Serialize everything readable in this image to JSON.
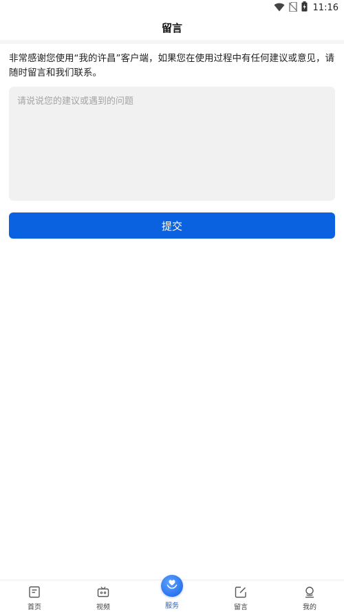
{
  "status_bar": {
    "time": "11:16",
    "icons": [
      "wifi-icon",
      "no-sim-icon",
      "battery-charging-icon"
    ]
  },
  "header": {
    "title": "留言"
  },
  "intro_text": "非常感谢您使用“我的许昌”客户端，如果您在使用过程中有任何建议或意见，请随时留言和我们联系。",
  "feedback": {
    "placeholder": "请说说您的建议或遇到的问题",
    "value": ""
  },
  "submit": {
    "label": "提交"
  },
  "tabbar": {
    "items": [
      {
        "label": "首页",
        "icon": "home-doc-icon"
      },
      {
        "label": "视频",
        "icon": "tv-icon"
      },
      {
        "label": "服务",
        "icon": "heart-hand-icon",
        "active": true
      },
      {
        "label": "留言",
        "icon": "edit-note-icon"
      },
      {
        "label": "我的",
        "icon": "user-icon"
      }
    ]
  },
  "colors": {
    "accent": "#0a62e0",
    "active_tab": "#1d63d8",
    "input_bg": "#f1f1f1"
  }
}
